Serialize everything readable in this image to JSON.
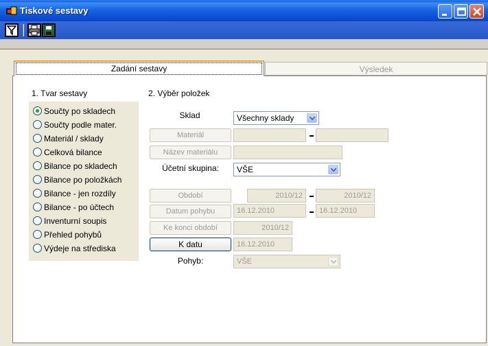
{
  "window": {
    "title": "Tiskové sestavy",
    "icon": "app-icon",
    "controls": [
      "minimize-icon",
      "maximize-icon",
      "close-icon"
    ]
  },
  "toolbar": {
    "buttons": [
      {
        "icon": "filter-icon"
      },
      {
        "icon": "print-icon"
      },
      {
        "icon": "save-icon"
      }
    ]
  },
  "tabs": [
    {
      "label": "Zadání sestavy",
      "active": true
    },
    {
      "label": "Výsledek",
      "active": false
    }
  ],
  "section1": {
    "title": "1. Tvar sestavy",
    "options": [
      {
        "label": "Součty po skladech",
        "checked": true
      },
      {
        "label": "Součty podle mater.",
        "checked": false
      },
      {
        "label": "Materiál / sklady",
        "checked": false
      },
      {
        "label": "Celková bilance",
        "checked": false
      },
      {
        "label": "Bilance po skladech",
        "checked": false
      },
      {
        "label": "Bilance po položkách",
        "checked": false
      },
      {
        "label": "Bilance - jen rozdíly",
        "checked": false
      },
      {
        "label": "Bilance - po účtech",
        "checked": false
      },
      {
        "label": "Inventurní soupis",
        "checked": false
      },
      {
        "label": "Přehled pohybů",
        "checked": false
      },
      {
        "label": "Výdeje na střediska",
        "checked": false
      }
    ]
  },
  "section2": {
    "title": "2. Výběr položek",
    "sklad": {
      "label": "Sklad",
      "value": "Všechny sklady"
    },
    "material": {
      "label": "Materiál",
      "from": "",
      "to": ""
    },
    "nazev_materialu": {
      "label": "Název materiálu",
      "value": ""
    },
    "ucetni_skupina": {
      "label": "Účetní skupina:",
      "value": "VŠE"
    },
    "obdobi": {
      "label": "Období",
      "from": "2010/12",
      "to": "2010/12"
    },
    "datum_pohybu": {
      "label": "Datum pohybu",
      "from": "16.12.2010",
      "to": "16.12.2010"
    },
    "ke_konci_obdobi": {
      "label": "Ke konci období",
      "value": "2010/12"
    },
    "k_datu": {
      "label": "K datu",
      "value": "16.12.2010"
    },
    "pohyb": {
      "label": "Pohyb:",
      "value": "VŠE"
    }
  },
  "colors": {
    "title_bar": "#0a4fd6",
    "face": "#ece9d8",
    "radio_check": "#21a121",
    "tab_accent": "#e8a33a"
  }
}
